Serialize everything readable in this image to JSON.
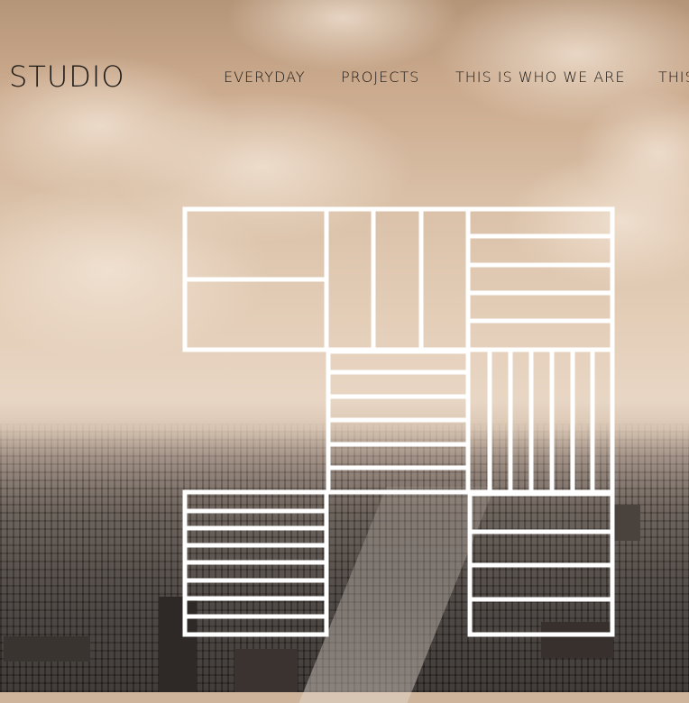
{
  "header": {
    "brand": "STUDIO",
    "nav": [
      {
        "label": "EVERYDAY"
      },
      {
        "label": "PROJECTS"
      },
      {
        "label": "THIS IS WHO WE ARE"
      },
      {
        "label": "THIS"
      }
    ]
  },
  "hero": {
    "background": "sepia aerial city photo with cloudy sky",
    "logo": "white grid mark"
  },
  "colors": {
    "text": "#1b1714",
    "logo_stroke": "#ffffff"
  }
}
